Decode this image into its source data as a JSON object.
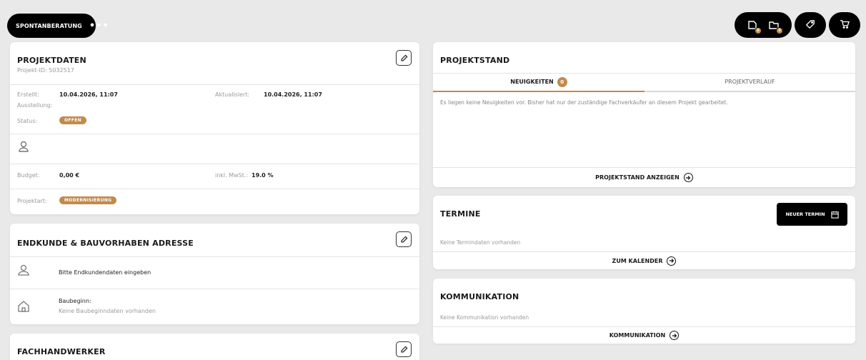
{
  "top": {
    "consult_label": "SPONTANBERATUNG",
    "more_label": "•••",
    "icon_badges": [
      "0",
      "0"
    ]
  },
  "projektdaten": {
    "title": "PROJEKTDATEN",
    "projekt_id": "Projekt-ID: 5032517",
    "erstellt_label": "Erstellt:",
    "erstellt_value": "10.04.2026, 11:07",
    "aktualisiert_label": "Aktualisiert:",
    "aktualisiert_value": "10.04.2026, 11:07",
    "ausstellung_label": "Ausstellung:",
    "status_label": "Status:",
    "status_value": "OFFEN",
    "budget_label": "Budget:",
    "budget_value": "0,00 €",
    "mwst_label": "inkl. MwSt.:",
    "mwst_value": "19.0 %",
    "projektart_label": "Projektart:",
    "projektart_value": "MODERNISIERUNG"
  },
  "endkunde": {
    "title": "ENDKUNDE & BAUVORHABEN ADRESSE",
    "customer_prompt": "Bitte Endkundendaten eingeben",
    "baubeginn_label": "Baubeginn:",
    "baubeginn_value": "Keine Baubeginndaten vorhanden"
  },
  "fachhandwerker": {
    "title": "FACHHANDWERKER"
  },
  "projektstand": {
    "title": "PROJEKTSTAND",
    "tab_news": "NEUIGKEITEN",
    "tab_news_count": "0",
    "tab_history": "PROJEKTVERLAUF",
    "message": "Es liegen keine Neuigkeiten vor. Bisher hat nur der zuständige Fachverkäufer an diesem Projekt gearbeitet.",
    "link": "PROJEKTSTAND ANZEIGEN"
  },
  "termine": {
    "title": "TERMINE",
    "new_button": "NEUER TERMIN",
    "empty": "Keine Termindaten vorhanden",
    "link": "ZUM KALENDER"
  },
  "kommunikation": {
    "title": "KOMMUNIKATION",
    "empty": "Keine Kommunikation vorhanden",
    "link": "KOMMUNIKATION"
  },
  "colors": {
    "accent": "#c28a4c",
    "black": "#000000",
    "background": "#e9e9e9"
  }
}
